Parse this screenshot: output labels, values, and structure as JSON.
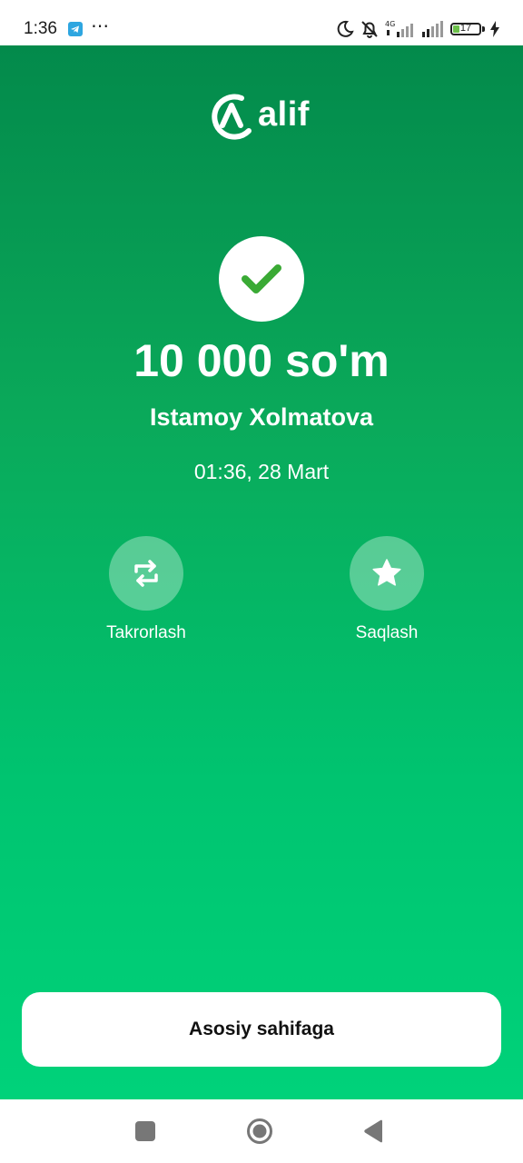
{
  "status_bar": {
    "time": "1:36",
    "battery_level": "17",
    "icons": [
      "telegram-icon",
      "more-dots-icon",
      "moon-icon",
      "muted-bell-icon",
      "signal-4g-icon",
      "signal-icon",
      "battery-icon",
      "charging-icon"
    ]
  },
  "app": {
    "logo_text": "alif",
    "brand_color": "#00c470"
  },
  "transaction": {
    "status_icon": "check-icon",
    "amount": "10 000 so'm",
    "recipient": "Istamoy Xolmatova",
    "datetime": "01:36, 28 Mart"
  },
  "actions": {
    "repeat_label": "Takrorlash",
    "repeat_icon": "repeat-icon",
    "save_label": "Saqlash",
    "save_icon": "star-icon"
  },
  "home_button": {
    "label": "Asosiy sahifaga"
  },
  "nav_bar": {
    "icons": [
      "recent-apps-icon",
      "home-icon",
      "back-icon"
    ]
  }
}
